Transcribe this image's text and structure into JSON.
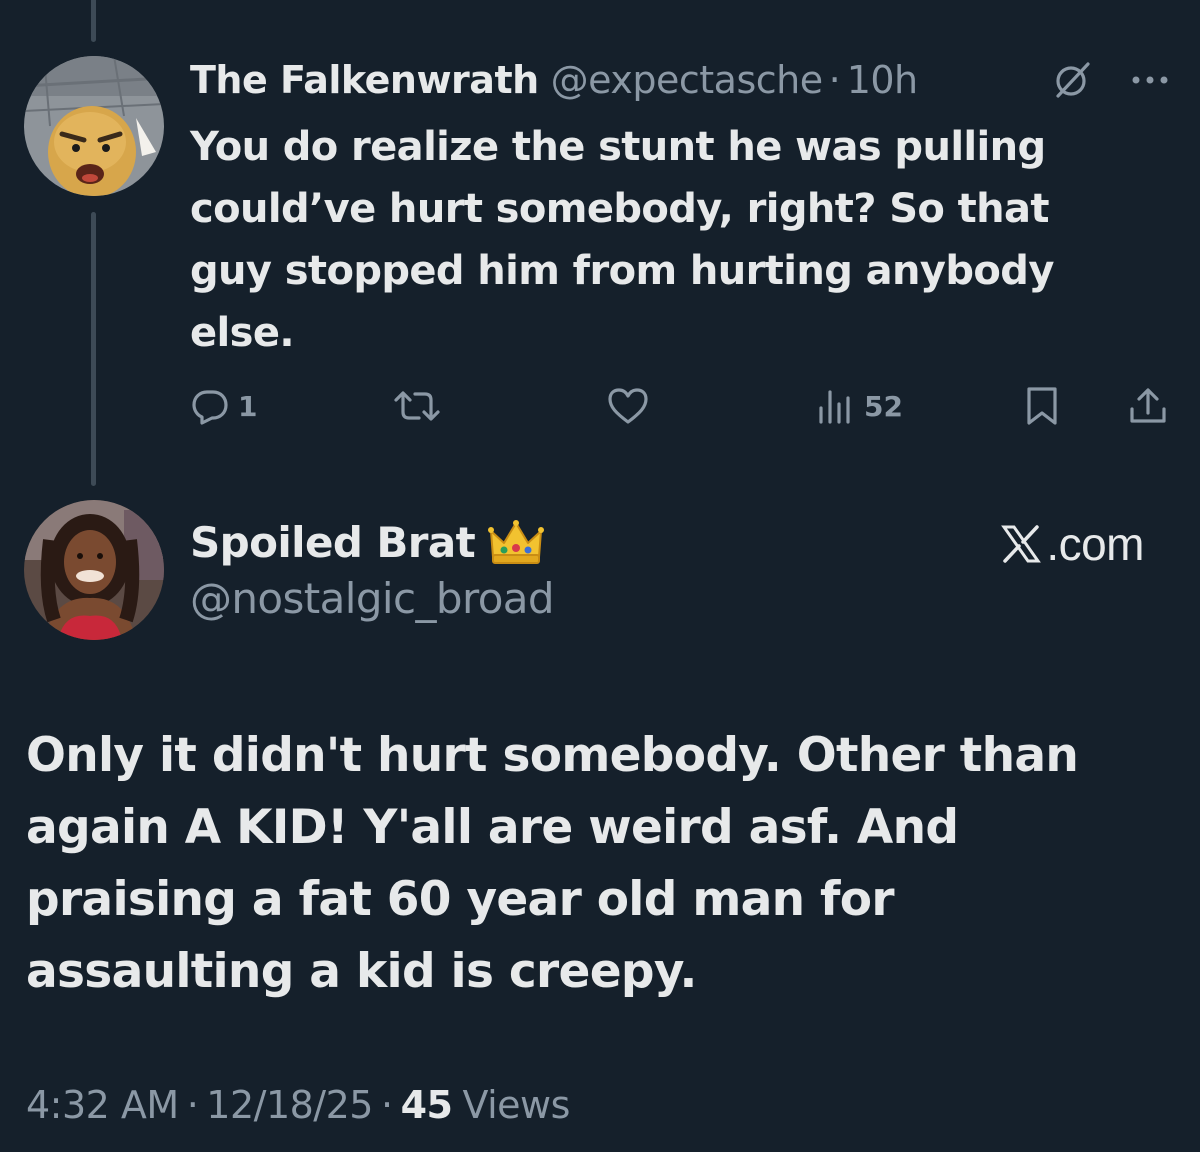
{
  "colors": {
    "background": "#15202b",
    "primary_text": "#e7e9ea",
    "secondary_text": "#8b98a5",
    "thread_line": "#3d4a56"
  },
  "reply_tweet": {
    "display_name": "The Falkenwrath",
    "handle": "@expectasche",
    "separator": "·",
    "time": "10h",
    "text": "You do realize the stunt he was pulling could’ve hurt somebody, right? So that guy stopped him from hurting anybody else.",
    "avatar_icon": "cartoon-avatar",
    "grok_icon": "grok-icon",
    "more_icon": "more-icon",
    "actions": {
      "reply_count": "1",
      "retweet_count": "",
      "like_count": "",
      "views_count": "52"
    }
  },
  "main_tweet": {
    "display_name": "Spoiled Brat",
    "name_emoji": "crown-emoji",
    "handle": "@nostalgic_broad",
    "brand": ".com",
    "brand_icon": "x-logo-icon",
    "text": "Only it didn't hurt somebody. Other than again A KID! Y'all are weird asf. And praising a fat 60 year old man for assaulting a kid is creepy.",
    "time": "4:32 AM",
    "date": "12/18/25",
    "separator": "·",
    "views_count": "45",
    "views_label": "Views"
  }
}
